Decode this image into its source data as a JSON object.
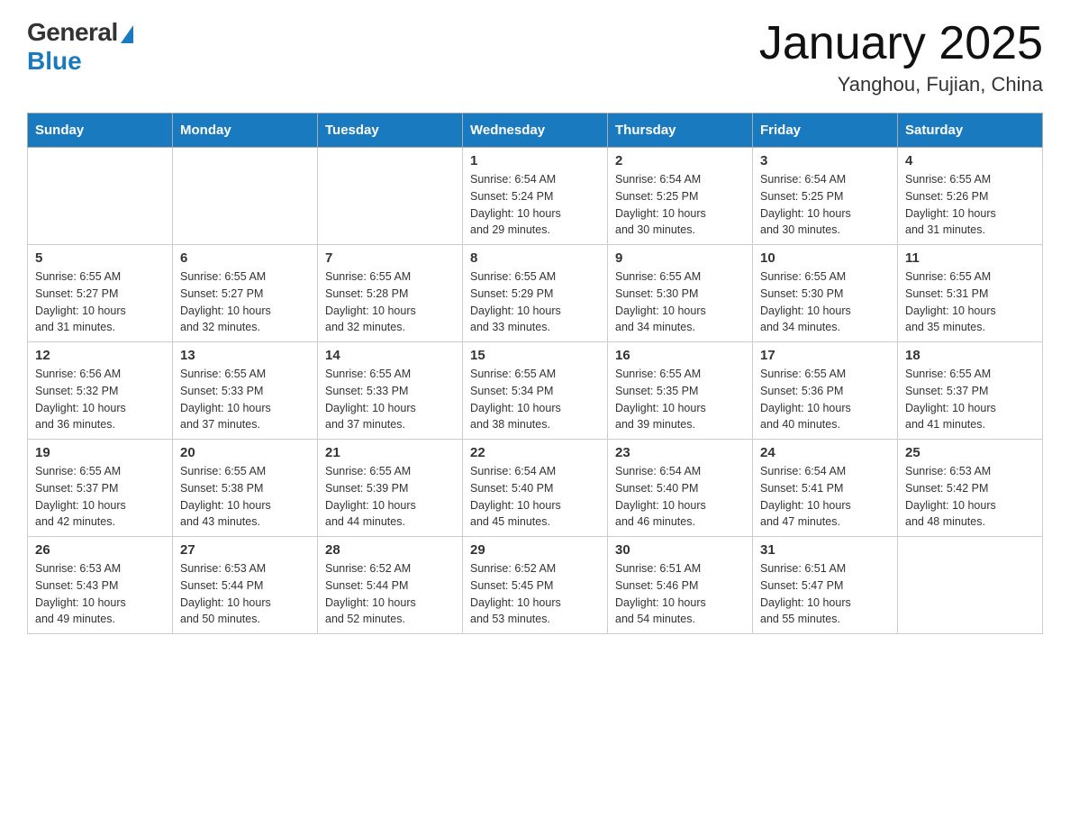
{
  "logo": {
    "general": "General",
    "blue": "Blue"
  },
  "title": {
    "month": "January 2025",
    "location": "Yanghou, Fujian, China"
  },
  "headers": [
    "Sunday",
    "Monday",
    "Tuesday",
    "Wednesday",
    "Thursday",
    "Friday",
    "Saturday"
  ],
  "weeks": [
    [
      {
        "day": "",
        "info": ""
      },
      {
        "day": "",
        "info": ""
      },
      {
        "day": "",
        "info": ""
      },
      {
        "day": "1",
        "info": "Sunrise: 6:54 AM\nSunset: 5:24 PM\nDaylight: 10 hours\nand 29 minutes."
      },
      {
        "day": "2",
        "info": "Sunrise: 6:54 AM\nSunset: 5:25 PM\nDaylight: 10 hours\nand 30 minutes."
      },
      {
        "day": "3",
        "info": "Sunrise: 6:54 AM\nSunset: 5:25 PM\nDaylight: 10 hours\nand 30 minutes."
      },
      {
        "day": "4",
        "info": "Sunrise: 6:55 AM\nSunset: 5:26 PM\nDaylight: 10 hours\nand 31 minutes."
      }
    ],
    [
      {
        "day": "5",
        "info": "Sunrise: 6:55 AM\nSunset: 5:27 PM\nDaylight: 10 hours\nand 31 minutes."
      },
      {
        "day": "6",
        "info": "Sunrise: 6:55 AM\nSunset: 5:27 PM\nDaylight: 10 hours\nand 32 minutes."
      },
      {
        "day": "7",
        "info": "Sunrise: 6:55 AM\nSunset: 5:28 PM\nDaylight: 10 hours\nand 32 minutes."
      },
      {
        "day": "8",
        "info": "Sunrise: 6:55 AM\nSunset: 5:29 PM\nDaylight: 10 hours\nand 33 minutes."
      },
      {
        "day": "9",
        "info": "Sunrise: 6:55 AM\nSunset: 5:30 PM\nDaylight: 10 hours\nand 34 minutes."
      },
      {
        "day": "10",
        "info": "Sunrise: 6:55 AM\nSunset: 5:30 PM\nDaylight: 10 hours\nand 34 minutes."
      },
      {
        "day": "11",
        "info": "Sunrise: 6:55 AM\nSunset: 5:31 PM\nDaylight: 10 hours\nand 35 minutes."
      }
    ],
    [
      {
        "day": "12",
        "info": "Sunrise: 6:56 AM\nSunset: 5:32 PM\nDaylight: 10 hours\nand 36 minutes."
      },
      {
        "day": "13",
        "info": "Sunrise: 6:55 AM\nSunset: 5:33 PM\nDaylight: 10 hours\nand 37 minutes."
      },
      {
        "day": "14",
        "info": "Sunrise: 6:55 AM\nSunset: 5:33 PM\nDaylight: 10 hours\nand 37 minutes."
      },
      {
        "day": "15",
        "info": "Sunrise: 6:55 AM\nSunset: 5:34 PM\nDaylight: 10 hours\nand 38 minutes."
      },
      {
        "day": "16",
        "info": "Sunrise: 6:55 AM\nSunset: 5:35 PM\nDaylight: 10 hours\nand 39 minutes."
      },
      {
        "day": "17",
        "info": "Sunrise: 6:55 AM\nSunset: 5:36 PM\nDaylight: 10 hours\nand 40 minutes."
      },
      {
        "day": "18",
        "info": "Sunrise: 6:55 AM\nSunset: 5:37 PM\nDaylight: 10 hours\nand 41 minutes."
      }
    ],
    [
      {
        "day": "19",
        "info": "Sunrise: 6:55 AM\nSunset: 5:37 PM\nDaylight: 10 hours\nand 42 minutes."
      },
      {
        "day": "20",
        "info": "Sunrise: 6:55 AM\nSunset: 5:38 PM\nDaylight: 10 hours\nand 43 minutes."
      },
      {
        "day": "21",
        "info": "Sunrise: 6:55 AM\nSunset: 5:39 PM\nDaylight: 10 hours\nand 44 minutes."
      },
      {
        "day": "22",
        "info": "Sunrise: 6:54 AM\nSunset: 5:40 PM\nDaylight: 10 hours\nand 45 minutes."
      },
      {
        "day": "23",
        "info": "Sunrise: 6:54 AM\nSunset: 5:40 PM\nDaylight: 10 hours\nand 46 minutes."
      },
      {
        "day": "24",
        "info": "Sunrise: 6:54 AM\nSunset: 5:41 PM\nDaylight: 10 hours\nand 47 minutes."
      },
      {
        "day": "25",
        "info": "Sunrise: 6:53 AM\nSunset: 5:42 PM\nDaylight: 10 hours\nand 48 minutes."
      }
    ],
    [
      {
        "day": "26",
        "info": "Sunrise: 6:53 AM\nSunset: 5:43 PM\nDaylight: 10 hours\nand 49 minutes."
      },
      {
        "day": "27",
        "info": "Sunrise: 6:53 AM\nSunset: 5:44 PM\nDaylight: 10 hours\nand 50 minutes."
      },
      {
        "day": "28",
        "info": "Sunrise: 6:52 AM\nSunset: 5:44 PM\nDaylight: 10 hours\nand 52 minutes."
      },
      {
        "day": "29",
        "info": "Sunrise: 6:52 AM\nSunset: 5:45 PM\nDaylight: 10 hours\nand 53 minutes."
      },
      {
        "day": "30",
        "info": "Sunrise: 6:51 AM\nSunset: 5:46 PM\nDaylight: 10 hours\nand 54 minutes."
      },
      {
        "day": "31",
        "info": "Sunrise: 6:51 AM\nSunset: 5:47 PM\nDaylight: 10 hours\nand 55 minutes."
      },
      {
        "day": "",
        "info": ""
      }
    ]
  ]
}
